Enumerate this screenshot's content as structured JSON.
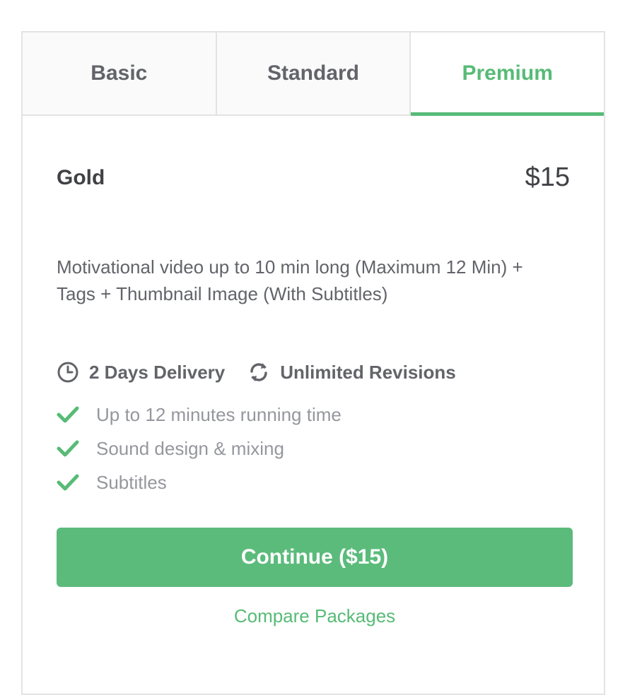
{
  "tabs": [
    {
      "label": "Basic",
      "active": false
    },
    {
      "label": "Standard",
      "active": false
    },
    {
      "label": "Premium",
      "active": true
    }
  ],
  "package": {
    "name": "Gold",
    "price": "$15",
    "description": "Motivational video up to 10 min long (Maximum 12 Min) + Tags + Thumbnail Image (With Subtitles)"
  },
  "meta": {
    "delivery": {
      "icon": "clock-icon",
      "label": "2 Days Delivery"
    },
    "revisions": {
      "icon": "refresh-icon",
      "label": "Unlimited Revisions"
    }
  },
  "features": [
    {
      "icon": "check-icon",
      "label": "Up to 12 minutes running time"
    },
    {
      "icon": "check-icon",
      "label": "Sound design & mixing"
    },
    {
      "icon": "check-icon",
      "label": "Subtitles"
    }
  ],
  "actions": {
    "continue_label": "Continue ($15)",
    "compare_label": "Compare Packages"
  },
  "colors": {
    "accent": "#57bb76",
    "button": "#5bbb7b",
    "text_dark": "#404145",
    "text_muted": "#95979d",
    "border": "#e3e3e3"
  }
}
